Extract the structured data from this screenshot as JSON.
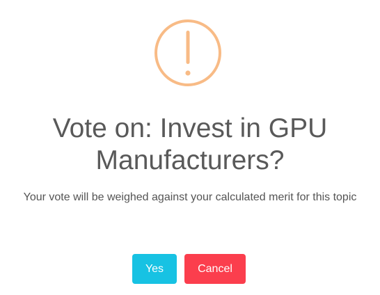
{
  "dialog": {
    "icon": "exclamation-warning-icon",
    "title": "Vote on: Invest in GPU Manufacturers?",
    "message": "Your vote will be weighed against your calculated merit for this topic",
    "confirm_label": "Yes",
    "cancel_label": "Cancel"
  },
  "colors": {
    "icon": "#F8BB86",
    "confirm": "#17C2E3",
    "cancel": "#FB3E4D",
    "title_text": "#595959",
    "message_text": "#545454"
  }
}
